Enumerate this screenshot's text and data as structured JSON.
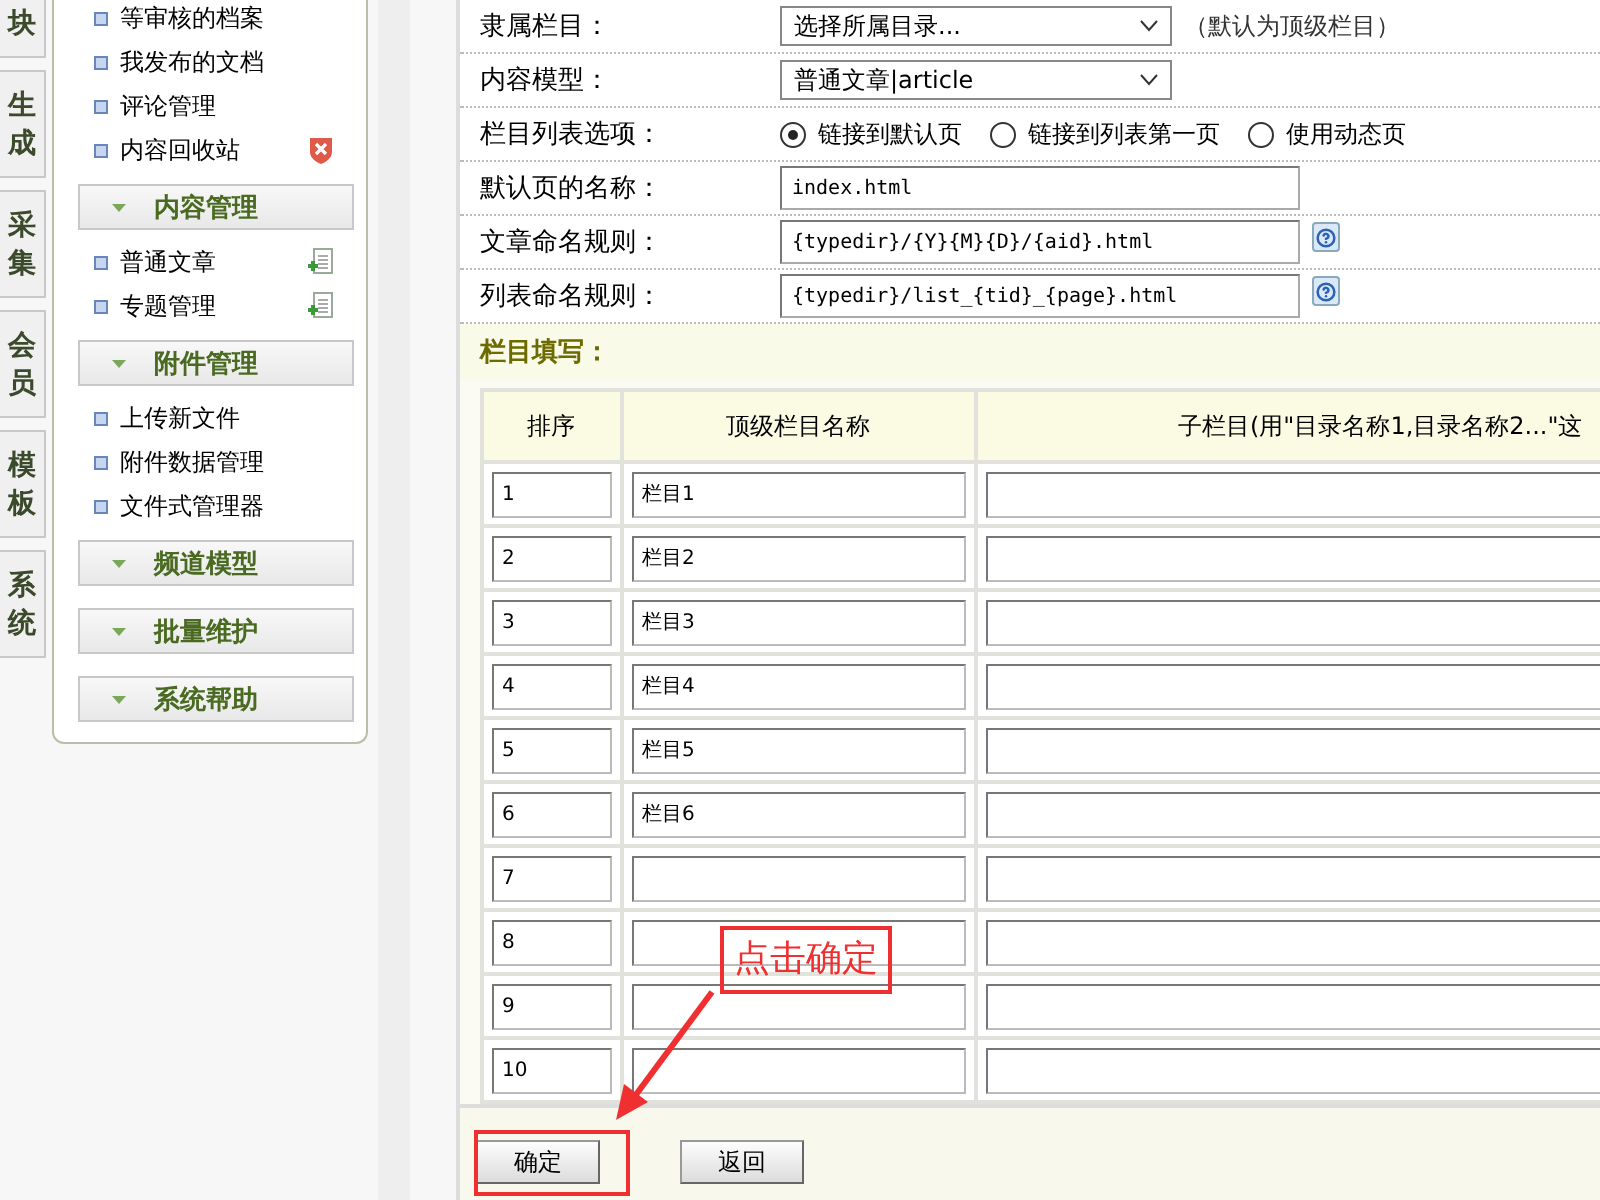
{
  "side_tabs": [
    {
      "label": "块"
    },
    {
      "label": "生成"
    },
    {
      "label": "采集"
    },
    {
      "label": "会员"
    },
    {
      "label": "模板"
    },
    {
      "label": "系统"
    }
  ],
  "menu": {
    "items": [
      {
        "label": "等审核的档案",
        "kind": "plain"
      },
      {
        "label": "我发布的文档",
        "kind": "plain"
      },
      {
        "label": "评论管理",
        "kind": "plain"
      },
      {
        "label": "内容回收站",
        "kind": "delete"
      }
    ],
    "sections": [
      {
        "title": "内容管理",
        "items": [
          {
            "label": "普通文章",
            "kind": "add"
          },
          {
            "label": "专题管理",
            "kind": "add"
          }
        ]
      },
      {
        "title": "附件管理",
        "items": [
          {
            "label": "上传新文件",
            "kind": "plain"
          },
          {
            "label": "附件数据管理",
            "kind": "plain"
          },
          {
            "label": "文件式管理器",
            "kind": "plain"
          }
        ]
      },
      {
        "title": "频道模型"
      },
      {
        "title": "批量维护"
      },
      {
        "title": "系统帮助"
      }
    ]
  },
  "form": {
    "rows": [
      {
        "kind": "select",
        "label": "隶属栏目：",
        "value": "选择所属目录...",
        "note": "（默认为顶级栏目）"
      },
      {
        "kind": "select",
        "label": "内容模型：",
        "value": "普通文章|article"
      },
      {
        "kind": "radio",
        "label": "栏目列表选项：",
        "options": [
          {
            "label": "链接到默认页",
            "selected": true
          },
          {
            "label": "链接到列表第一页",
            "selected": false
          },
          {
            "label": "使用动态页",
            "selected": false
          }
        ]
      },
      {
        "kind": "text",
        "label": "默认页的名称：",
        "value": "index.html",
        "help": false
      },
      {
        "kind": "text",
        "label": "文章命名规则：",
        "value": "{typedir}/{Y}{M}{D}/{aid}.html",
        "help": true
      },
      {
        "kind": "text",
        "label": "列表命名规则：",
        "value": "{typedir}/list_{tid}_{page}.html",
        "help": true
      }
    ],
    "section_title": "栏目填写："
  },
  "table": {
    "columns": [
      "排序",
      "顶级栏目名称",
      "子栏目(用\"目录名称1,目录名称2...\"这"
    ],
    "rows": [
      {
        "order": "1",
        "name": "栏目1"
      },
      {
        "order": "2",
        "name": "栏目2"
      },
      {
        "order": "3",
        "name": "栏目3"
      },
      {
        "order": "4",
        "name": "栏目4"
      },
      {
        "order": "5",
        "name": "栏目5"
      },
      {
        "order": "6",
        "name": "栏目6"
      },
      {
        "order": "7"
      },
      {
        "order": "8"
      },
      {
        "order": "9"
      },
      {
        "order": "10"
      }
    ]
  },
  "buttons": [
    {
      "label": "确定",
      "highlighted": true
    },
    {
      "label": "返回",
      "highlighted": false
    }
  ],
  "annotation": {
    "text": "点击确定"
  }
}
